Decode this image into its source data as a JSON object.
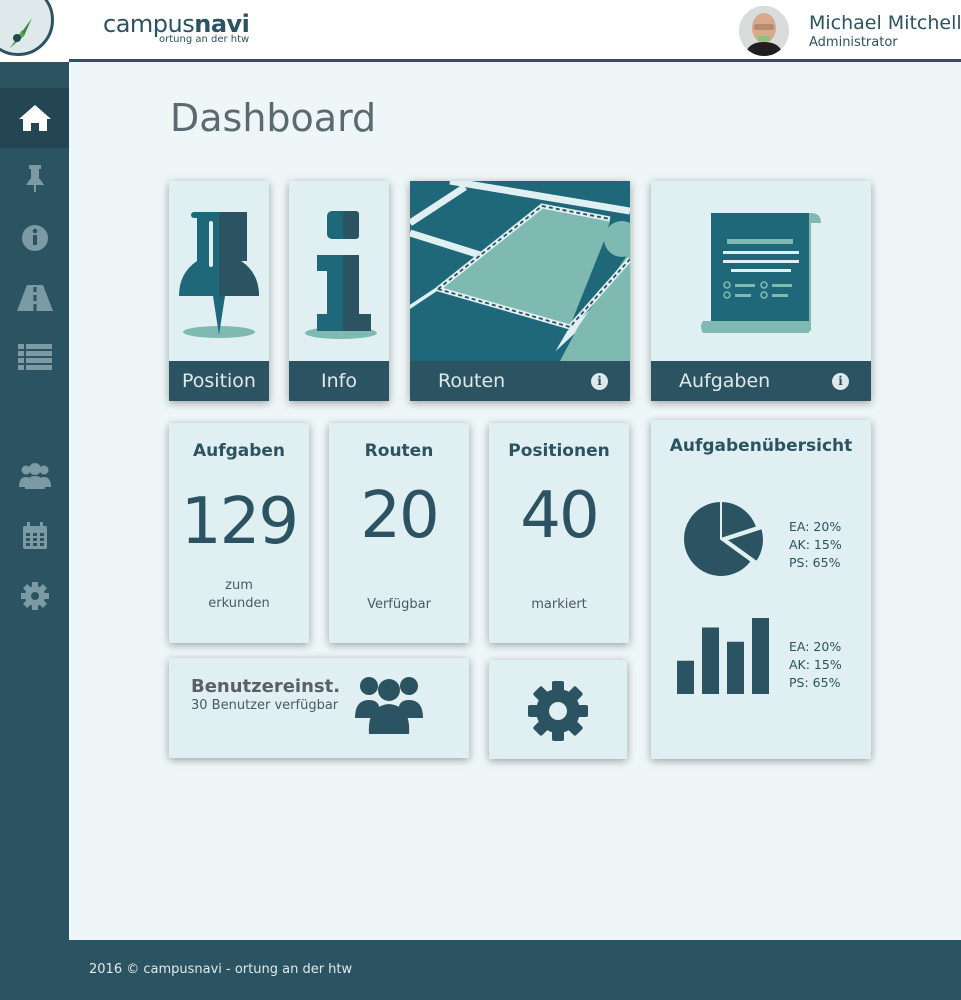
{
  "brand": {
    "name_light": "campus",
    "name_bold": "navi",
    "tagline": "ortung an der htw"
  },
  "user": {
    "name": "Michael Mitchell",
    "role": "Administrator"
  },
  "sidebar": {
    "items": [
      {
        "icon": "home-icon",
        "active": true
      },
      {
        "icon": "pin-icon",
        "active": false
      },
      {
        "icon": "info-icon",
        "active": false
      },
      {
        "icon": "road-icon",
        "active": false
      },
      {
        "icon": "list-icon",
        "active": false
      },
      {
        "icon": "users-icon",
        "active": false
      },
      {
        "icon": "calendar-icon",
        "active": false
      },
      {
        "icon": "gear-icon",
        "active": false
      }
    ]
  },
  "main": {
    "title": "Dashboard",
    "tiles": {
      "position": {
        "label": "Position",
        "icon": "pushpin-icon"
      },
      "info": {
        "label": "Info",
        "icon": "info-letter-icon"
      },
      "routen": {
        "label": "Routen",
        "icon": "map-routes-icon"
      },
      "aufgaben": {
        "label": "Aufgaben",
        "icon": "scroll-checklist-icon"
      }
    },
    "stats": [
      {
        "title": "Aufgaben",
        "value": "129",
        "caption_line1": "zum",
        "caption_line2": "erkunden"
      },
      {
        "title": "Routen",
        "value": "20",
        "caption": "Verfügbar"
      },
      {
        "title": "Positionen",
        "value": "40",
        "caption": "markiert"
      }
    ],
    "overview": {
      "title": "Aufgabenübersicht",
      "legend": [
        "EA: 20%",
        "AK: 15%",
        "PS: 65%"
      ]
    },
    "users_tile": {
      "title": "Benutzereinst.",
      "subtitle": "30 Benutzer verfügbar"
    }
  },
  "chart_data": [
    {
      "type": "pie",
      "categories": [
        "EA",
        "AK",
        "PS"
      ],
      "values": [
        20,
        15,
        65
      ]
    },
    {
      "type": "bar",
      "values": [
        35,
        70,
        55,
        80
      ]
    }
  ],
  "colors": {
    "primary": "#2c5361",
    "accent_teal": "#7fbab2",
    "tile_bg": "#e0eff1",
    "page_bg": "#eef6f8"
  },
  "footer": {
    "text": "2016 © campusnavi - ortung an der htw"
  }
}
